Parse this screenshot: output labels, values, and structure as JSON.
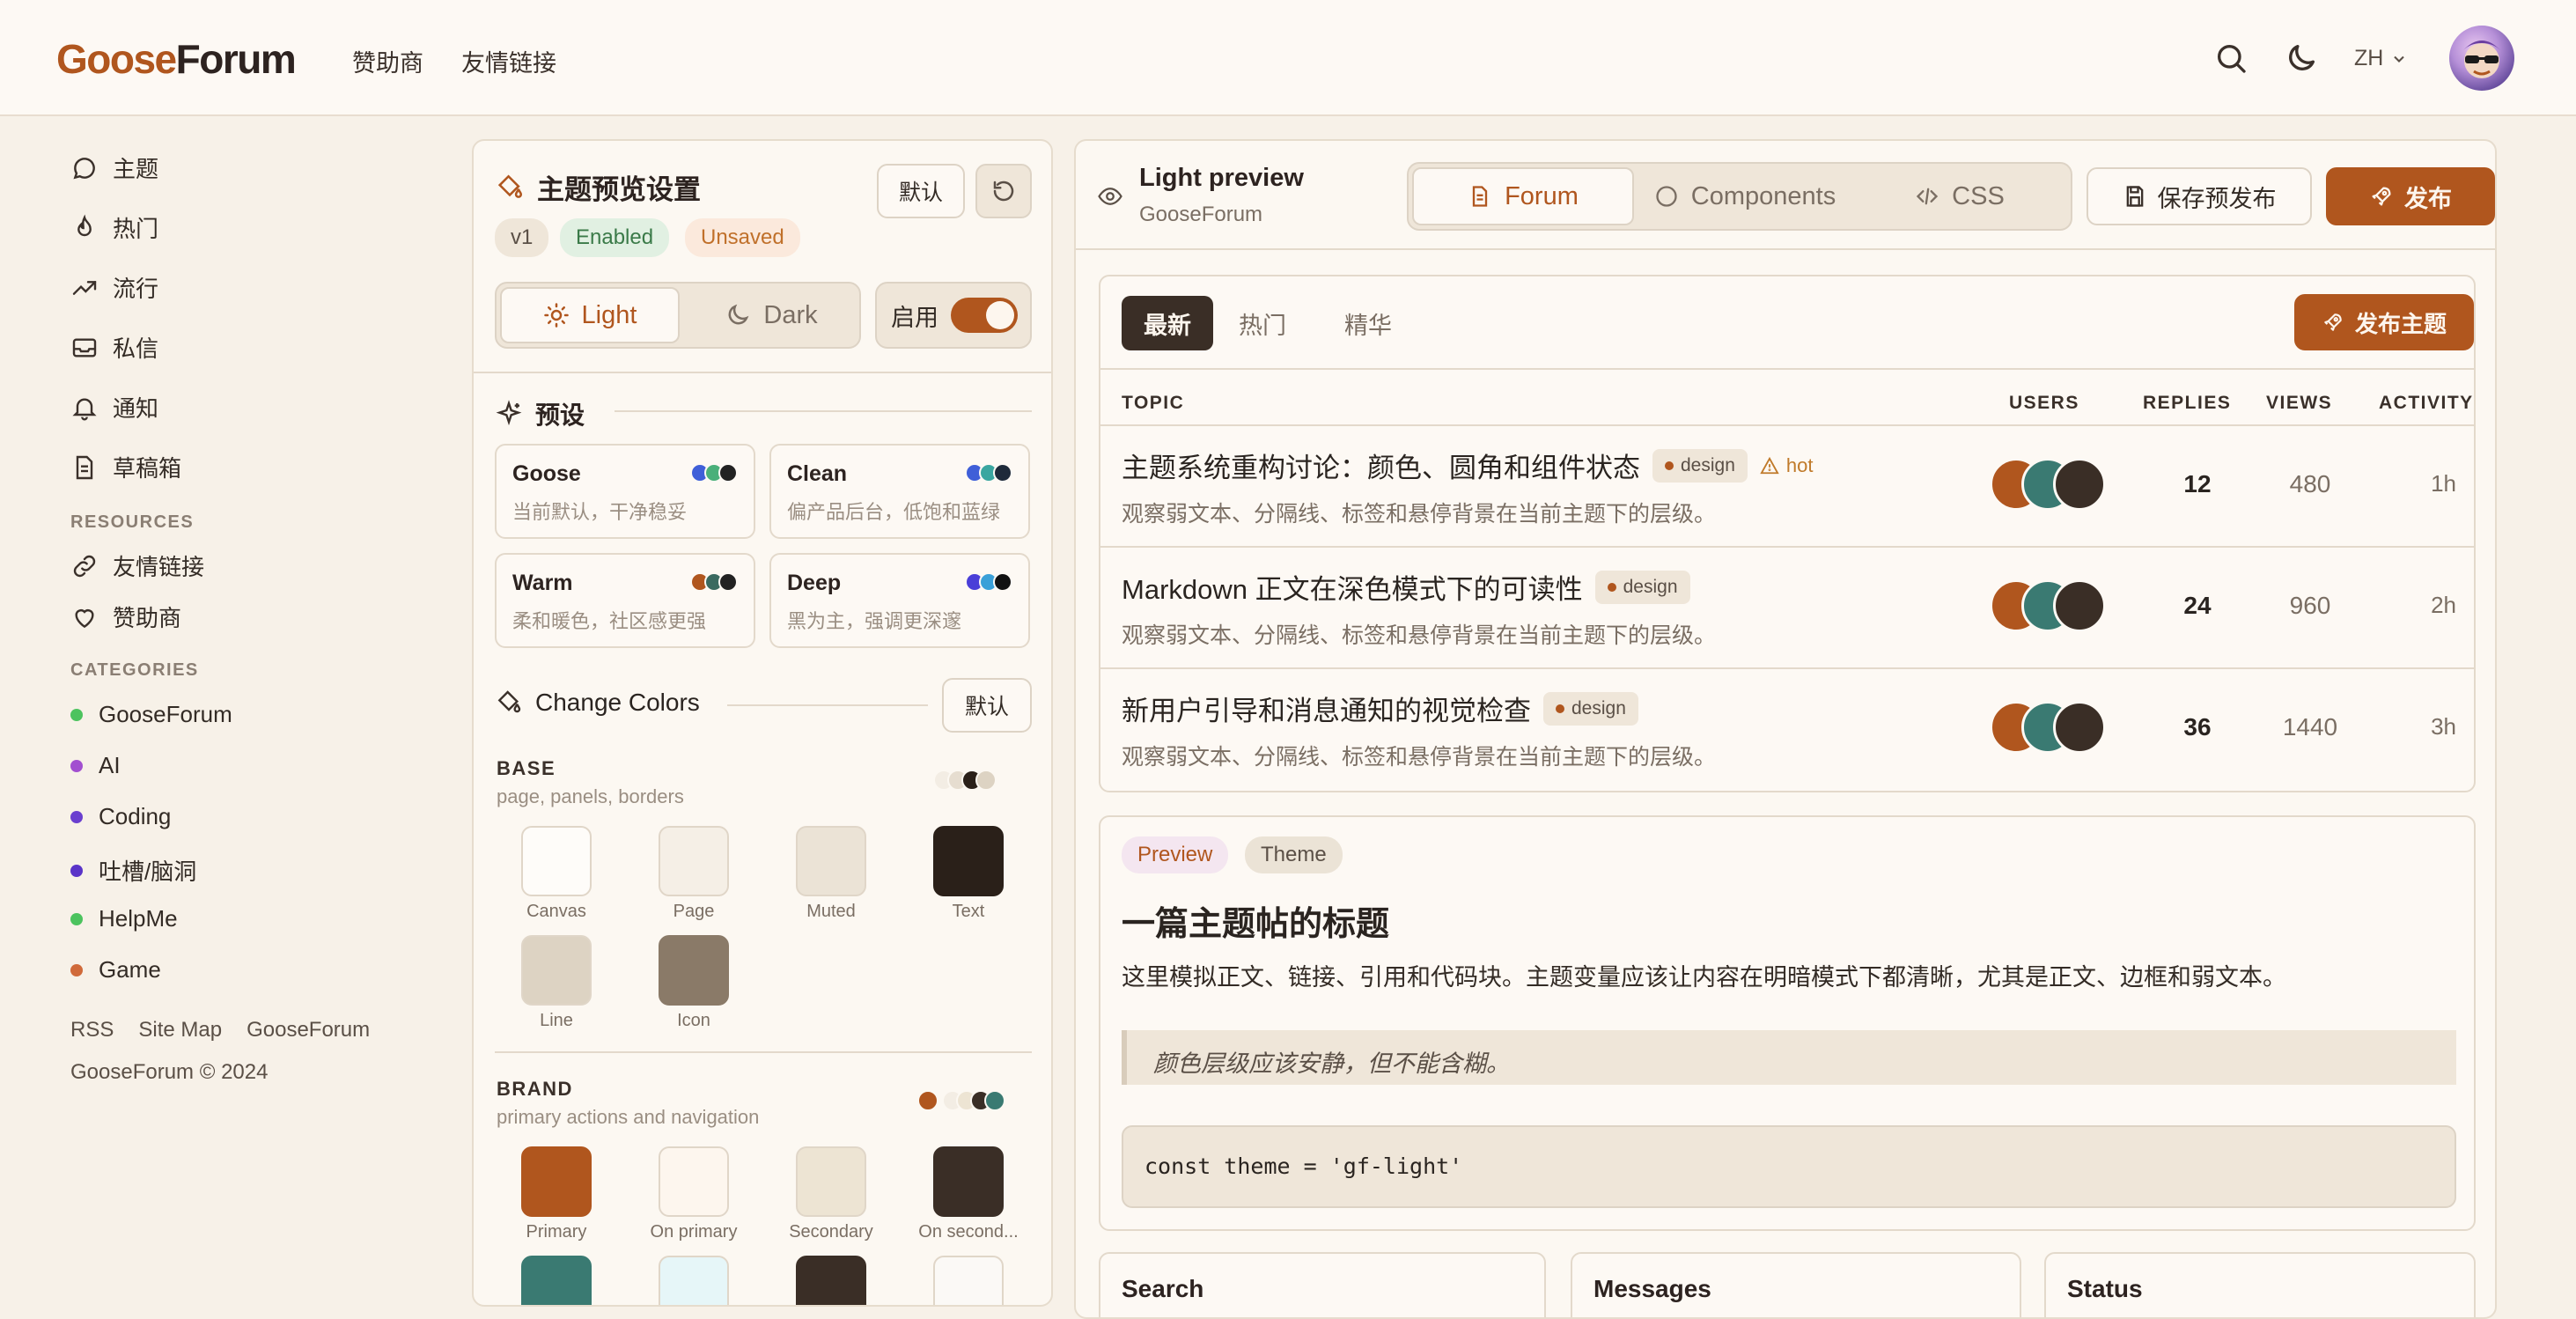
{
  "brand": {
    "part1": "Goose",
    "part2": "Forum"
  },
  "topnav": {
    "sponsors": "赞助商",
    "links": "友情链接",
    "lang": "ZH"
  },
  "sidebar": {
    "items": [
      {
        "label": "主题",
        "icon": "chat-bubble-icon"
      },
      {
        "label": "热门",
        "icon": "flame-icon"
      },
      {
        "label": "流行",
        "icon": "trending-up-icon"
      },
      {
        "label": "私信",
        "icon": "inbox-icon"
      },
      {
        "label": "通知",
        "icon": "bell-icon"
      },
      {
        "label": "草稿箱",
        "icon": "document-icon"
      }
    ],
    "resources_head": "RESOURCES",
    "resources": [
      {
        "label": "友情链接",
        "icon": "link-icon"
      },
      {
        "label": "赞助商",
        "icon": "heart-icon"
      }
    ],
    "categories_head": "CATEGORIES",
    "categories": [
      {
        "label": "GooseForum",
        "color": "#4cc35e"
      },
      {
        "label": "AI",
        "color": "#a24fd0"
      },
      {
        "label": "Coding",
        "color": "#6a3fcf"
      },
      {
        "label": "吐槽/脑洞",
        "color": "#5a34c8"
      },
      {
        "label": "HelpMe",
        "color": "#4cc35e"
      },
      {
        "label": "Game",
        "color": "#d06a3a"
      }
    ],
    "footer_links": [
      "RSS",
      "Site Map",
      "GooseForum"
    ],
    "copyright": "GooseForum © 2024"
  },
  "settings": {
    "title": "主题预览设置",
    "default_btn": "默认",
    "version": "v1",
    "enabled_badge": "Enabled",
    "unsaved_badge": "Unsaved",
    "mode_light": "Light",
    "mode_dark": "Dark",
    "enable_label": "启用",
    "enable_on": true,
    "presets_title": "预设",
    "presets": [
      {
        "name": "Goose",
        "desc": "当前默认，干净稳妥",
        "colors": [
          "#3f5fd8",
          "#4ab07a",
          "#222222"
        ]
      },
      {
        "name": "Clean",
        "desc": "偏产品后台，低饱和蓝绿",
        "colors": [
          "#3f5fd8",
          "#3aa6a0",
          "#1e2a3a"
        ]
      },
      {
        "name": "Warm",
        "desc": "柔和暖色，社区感更强",
        "colors": [
          "#b0561e",
          "#3a6a60",
          "#222222"
        ]
      },
      {
        "name": "Deep",
        "desc": "黑为主，强调更深邃",
        "colors": [
          "#4a3fd8",
          "#3aa0d8",
          "#111111"
        ]
      }
    ],
    "change_colors_title": "Change Colors",
    "change_default_btn": "默认",
    "base": {
      "head": "BASE",
      "sub": "page, panels, borders",
      "swatches": [
        {
          "label": "Canvas",
          "color": "#fefcf9"
        },
        {
          "label": "Page",
          "color": "#f5efe6"
        },
        {
          "label": "Muted",
          "color": "#ebe3d6"
        },
        {
          "label": "Text",
          "color": "#2a2019"
        },
        {
          "label": "Line",
          "color": "#ddd3c3"
        },
        {
          "label": "Icon",
          "color": "#8a7a68"
        }
      ],
      "mini": [
        "#f3ede4",
        "#e6ddd0",
        "#2a2019",
        "#ddd3c3"
      ]
    },
    "brand_group": {
      "head": "BRAND",
      "sub": "primary actions and navigation",
      "swatches": [
        {
          "label": "Primary",
          "color": "#b0561e"
        },
        {
          "label": "On primary",
          "color": "#fdf6ee"
        },
        {
          "label": "Secondary",
          "color": "#ede4d3"
        },
        {
          "label": "On second...",
          "color": "#3a2e26"
        },
        {
          "label": "",
          "color": "#3a7a72"
        },
        {
          "label": "",
          "color": "#e6f6f8"
        },
        {
          "label": "",
          "color": "#3a2e26"
        },
        {
          "label": "",
          "color": "#fbf9f6"
        }
      ],
      "mini": [
        "#b0561e",
        "#f3ede4",
        "#ede4d3",
        "#3a2e26",
        "#3a7a72"
      ]
    }
  },
  "preview": {
    "title": "Light preview",
    "subtitle": "GooseForum",
    "tabs": [
      "Forum",
      "Components",
      "CSS"
    ],
    "save_btn": "保存预发布",
    "publish_btn": "发布",
    "forum_tabs": [
      "最新",
      "热门",
      "精华"
    ],
    "new_topic_btn": "发布主题",
    "columns": [
      "TOPIC",
      "USERS",
      "REPLIES",
      "VIEWS",
      "ACTIVITY"
    ],
    "topics": [
      {
        "title": "主题系统重构讨论：颜色、圆角和组件状态",
        "tag": "design",
        "hot": "hot",
        "sub": "观察弱文本、分隔线、标签和悬停背景在当前主题下的层级。",
        "replies": "12",
        "views": "480",
        "activity": "1h"
      },
      {
        "title": "Markdown 正文在深色模式下的可读性",
        "tag": "design",
        "hot": "",
        "sub": "观察弱文本、分隔线、标签和悬停背景在当前主题下的层级。",
        "replies": "24",
        "views": "960",
        "activity": "2h"
      },
      {
        "title": "新用户引导和消息通知的视觉检查",
        "tag": "design",
        "hot": "",
        "sub": "观察弱文本、分隔线、标签和悬停背景在当前主题下的层级。",
        "replies": "36",
        "views": "1440",
        "activity": "3h"
      }
    ],
    "avatar_colors": [
      "#b0561e",
      "#3a7a72",
      "#3a2e26"
    ],
    "post": {
      "badge1": "Preview",
      "badge2": "Theme",
      "title": "一篇主题帖的标题",
      "body": "这里模拟正文、链接、引用和代码块。主题变量应该让内容在明暗模式下都清晰，尤其是正文、边框和弱文本。",
      "quote": "颜色层级应该安静，但不能含糊。",
      "code": "const theme = 'gf-light'"
    },
    "cards": [
      "Search",
      "Messages",
      "Status"
    ]
  }
}
